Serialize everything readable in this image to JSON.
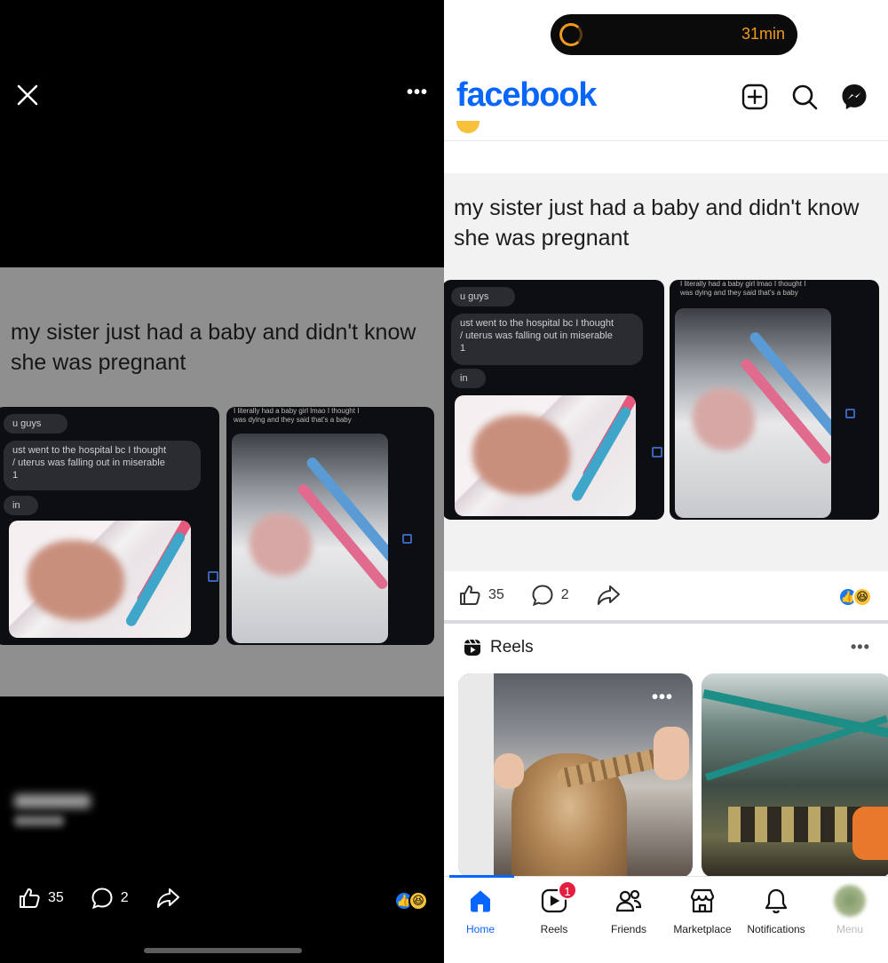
{
  "viewer": {
    "post_text": "my sister just had a baby and didn't know she was pregnant",
    "screenshot_messages": {
      "msg1": "u guys",
      "msg2": "ust went to the hospital bc I  thought\n/ uterus was falling out in miserable\n1",
      "msg3": "in",
      "caption": "I literally had a baby girl lmao I thought I\nwas dying and they said that's a baby"
    },
    "like_count": "35",
    "comment_count": "2",
    "emoji": "😂"
  },
  "status": {
    "timer_text": "31min"
  },
  "header": {
    "logo": "facebook"
  },
  "feed_post": {
    "post_text": "my sister just had a baby and didn't know she was pregnant",
    "like_count": "35",
    "comment_count": "2"
  },
  "reels": {
    "title": "Reels"
  },
  "nav": {
    "items": [
      {
        "label": "Home"
      },
      {
        "label": "Reels",
        "badge": "1"
      },
      {
        "label": "Friends"
      },
      {
        "label": "Marketplace"
      },
      {
        "label": "Notifications"
      },
      {
        "label": "Menu"
      }
    ]
  },
  "colors": {
    "brand_blue": "#0866ff",
    "badge_red": "#e41e3f",
    "timer_orange": "#f29a1e"
  }
}
